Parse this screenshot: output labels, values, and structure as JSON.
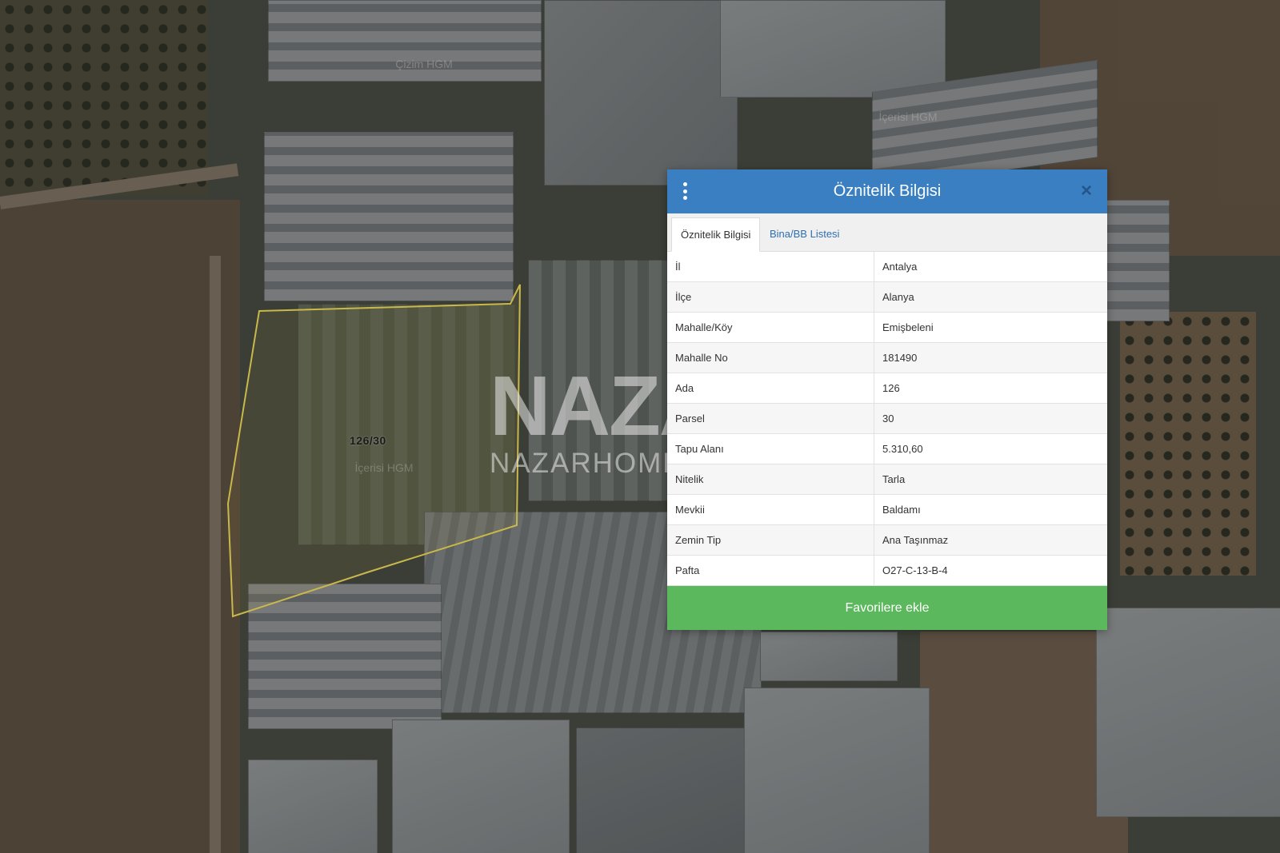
{
  "map": {
    "parcel_label": "126/30",
    "hgm_labels": [
      "Çizim HGM",
      "İçerisi HGM",
      "İçerisi HGM"
    ],
    "watermark": {
      "big": "NAZAR",
      "small": "NAZARHOME.COM"
    }
  },
  "popup": {
    "title": "Öznitelik Bilgisi",
    "close_symbol": "×",
    "tabs": [
      {
        "label": "Öznitelik Bilgisi"
      },
      {
        "label": "Bina/BB Listesi"
      }
    ],
    "rows": [
      {
        "key": "İl",
        "value": "Antalya"
      },
      {
        "key": "İlçe",
        "value": "Alanya"
      },
      {
        "key": "Mahalle/Köy",
        "value": "Emişbeleni"
      },
      {
        "key": "Mahalle No",
        "value": "181490"
      },
      {
        "key": "Ada",
        "value": "126"
      },
      {
        "key": "Parsel",
        "value": "30"
      },
      {
        "key": "Tapu Alanı",
        "value": "5.310,60"
      },
      {
        "key": "Nitelik",
        "value": "Tarla"
      },
      {
        "key": "Mevkii",
        "value": "Baldamı"
      },
      {
        "key": "Zemin Tip",
        "value": "Ana Taşınmaz"
      },
      {
        "key": "Pafta",
        "value": "O27-C-13-B-4"
      }
    ],
    "favorite_button": "Favorilere ekle"
  },
  "colors": {
    "header_blue": "#3a7fc1",
    "button_green": "#5cb85c",
    "tab_link_blue": "#2f6fb0",
    "parcel_outline": "#c9b84a"
  }
}
